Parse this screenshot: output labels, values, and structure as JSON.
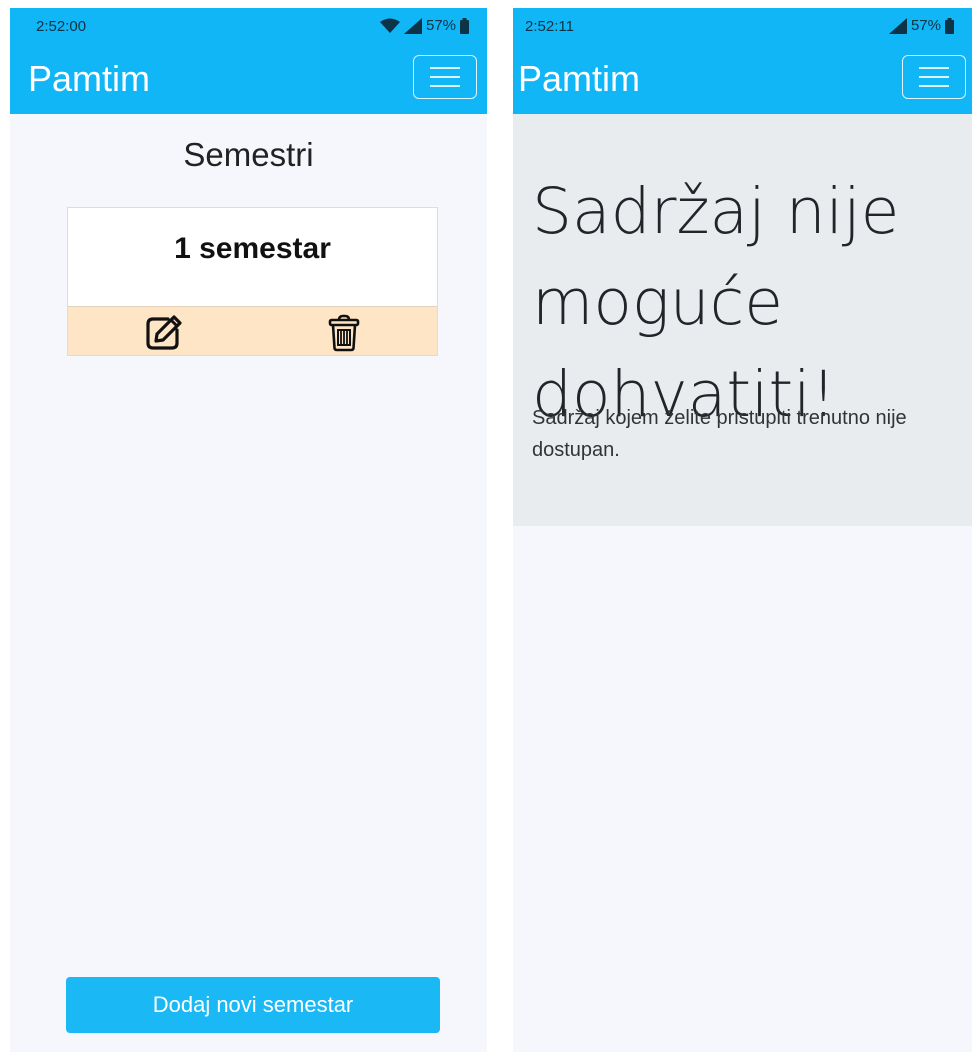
{
  "left_screen": {
    "status_time": "2:52:00",
    "battery": "57%",
    "app_title": "Pamtim",
    "heading": "Semestri",
    "semesters": [
      {
        "name": "1 semestar"
      }
    ],
    "add_button_label": "Dodaj novi semestar"
  },
  "right_screen": {
    "status_time": "2:52:11",
    "battery": "57%",
    "app_title": "Pamtim",
    "error_heading": "Sadržaj nije moguće dohvatiti!",
    "error_text": "Sadržaj kojem želite pristupiti trenutno nije dostupan."
  },
  "colors": {
    "accent": "#10b6f6",
    "card_actions_bg": "#fde5c6",
    "error_panel_bg": "#e9ecef"
  },
  "icons": [
    "menu-icon",
    "edit-icon",
    "trash-icon",
    "wifi-icon",
    "signal-icon",
    "battery-icon"
  ]
}
